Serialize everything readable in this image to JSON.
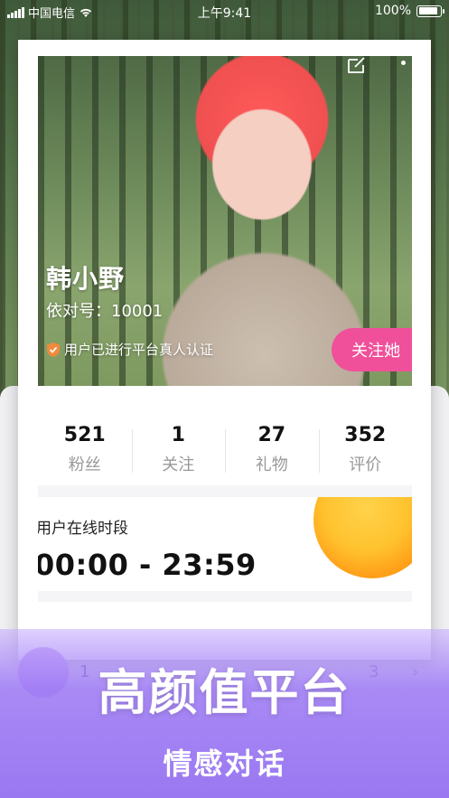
{
  "status_bar": {
    "carrier": "中国电信",
    "time": "上午9:41",
    "battery": "100%",
    "battery_level": 1.0
  },
  "profile": {
    "name": "韩小野",
    "uid_label": "依对号：",
    "uid_value": "10001",
    "verified_text": "用户已进行平台真人认证",
    "follow_button": "关注她"
  },
  "stats": [
    {
      "value": "521",
      "label": "粉丝"
    },
    {
      "value": "1",
      "label": "关注"
    },
    {
      "value": "27",
      "label": "礼物"
    },
    {
      "value": "352",
      "label": "评价"
    }
  ],
  "online": {
    "title": "用户在线时段",
    "time_range": "00:00 - 23:59"
  },
  "background_list": {
    "left_number": "1",
    "right_number": "3"
  },
  "promo": {
    "headline": "高颜值平台",
    "subline": "情感对话"
  },
  "colors": {
    "follow_pink": "#f0509a",
    "promo_purple": "#9a78f2",
    "sun_orange": "#ffc22e"
  },
  "icons": [
    "signal-icon",
    "wifi-icon",
    "battery-icon",
    "edit-icon",
    "more-icon",
    "shield-check-icon",
    "chevron-right-icon"
  ]
}
